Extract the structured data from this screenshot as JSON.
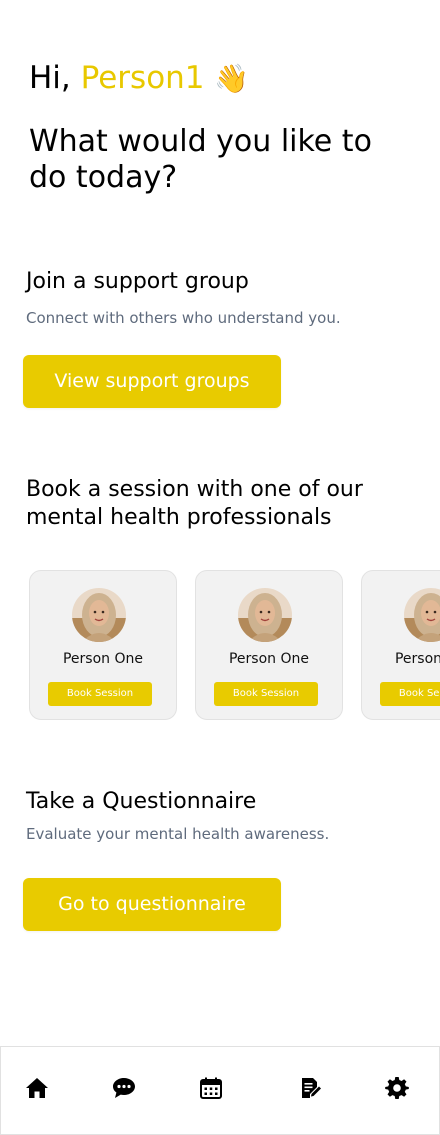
{
  "greeting": {
    "prefix": "Hi, ",
    "name": "Person1",
    "emoji": "👋"
  },
  "headline": "What would you like to do today?",
  "support_group": {
    "title": "Join a support group",
    "subtitle": "Connect with others who understand you.",
    "button_label": "View support groups"
  },
  "sessions": {
    "title": "Book a session with one of our mental health professionals",
    "professionals": [
      {
        "name": "Person One",
        "button_label": "Book Session"
      },
      {
        "name": "Person One",
        "button_label": "Book Session"
      },
      {
        "name": "Person One",
        "button_label": "Book Session"
      }
    ]
  },
  "questionnaire": {
    "title": "Take a Questionnaire",
    "subtitle": "Evaluate your mental health awareness.",
    "button_label": "Go to questionnaire"
  },
  "bottom_nav": {
    "items": [
      {
        "icon": "home-icon"
      },
      {
        "icon": "chat-icon"
      },
      {
        "icon": "calendar-icon"
      },
      {
        "icon": "notes-edit-icon"
      },
      {
        "icon": "settings-gear-icon"
      }
    ]
  },
  "colors": {
    "accent": "#e8cb00",
    "subtitle": "#5f6b7d",
    "card_background": "#f2f2f2"
  }
}
